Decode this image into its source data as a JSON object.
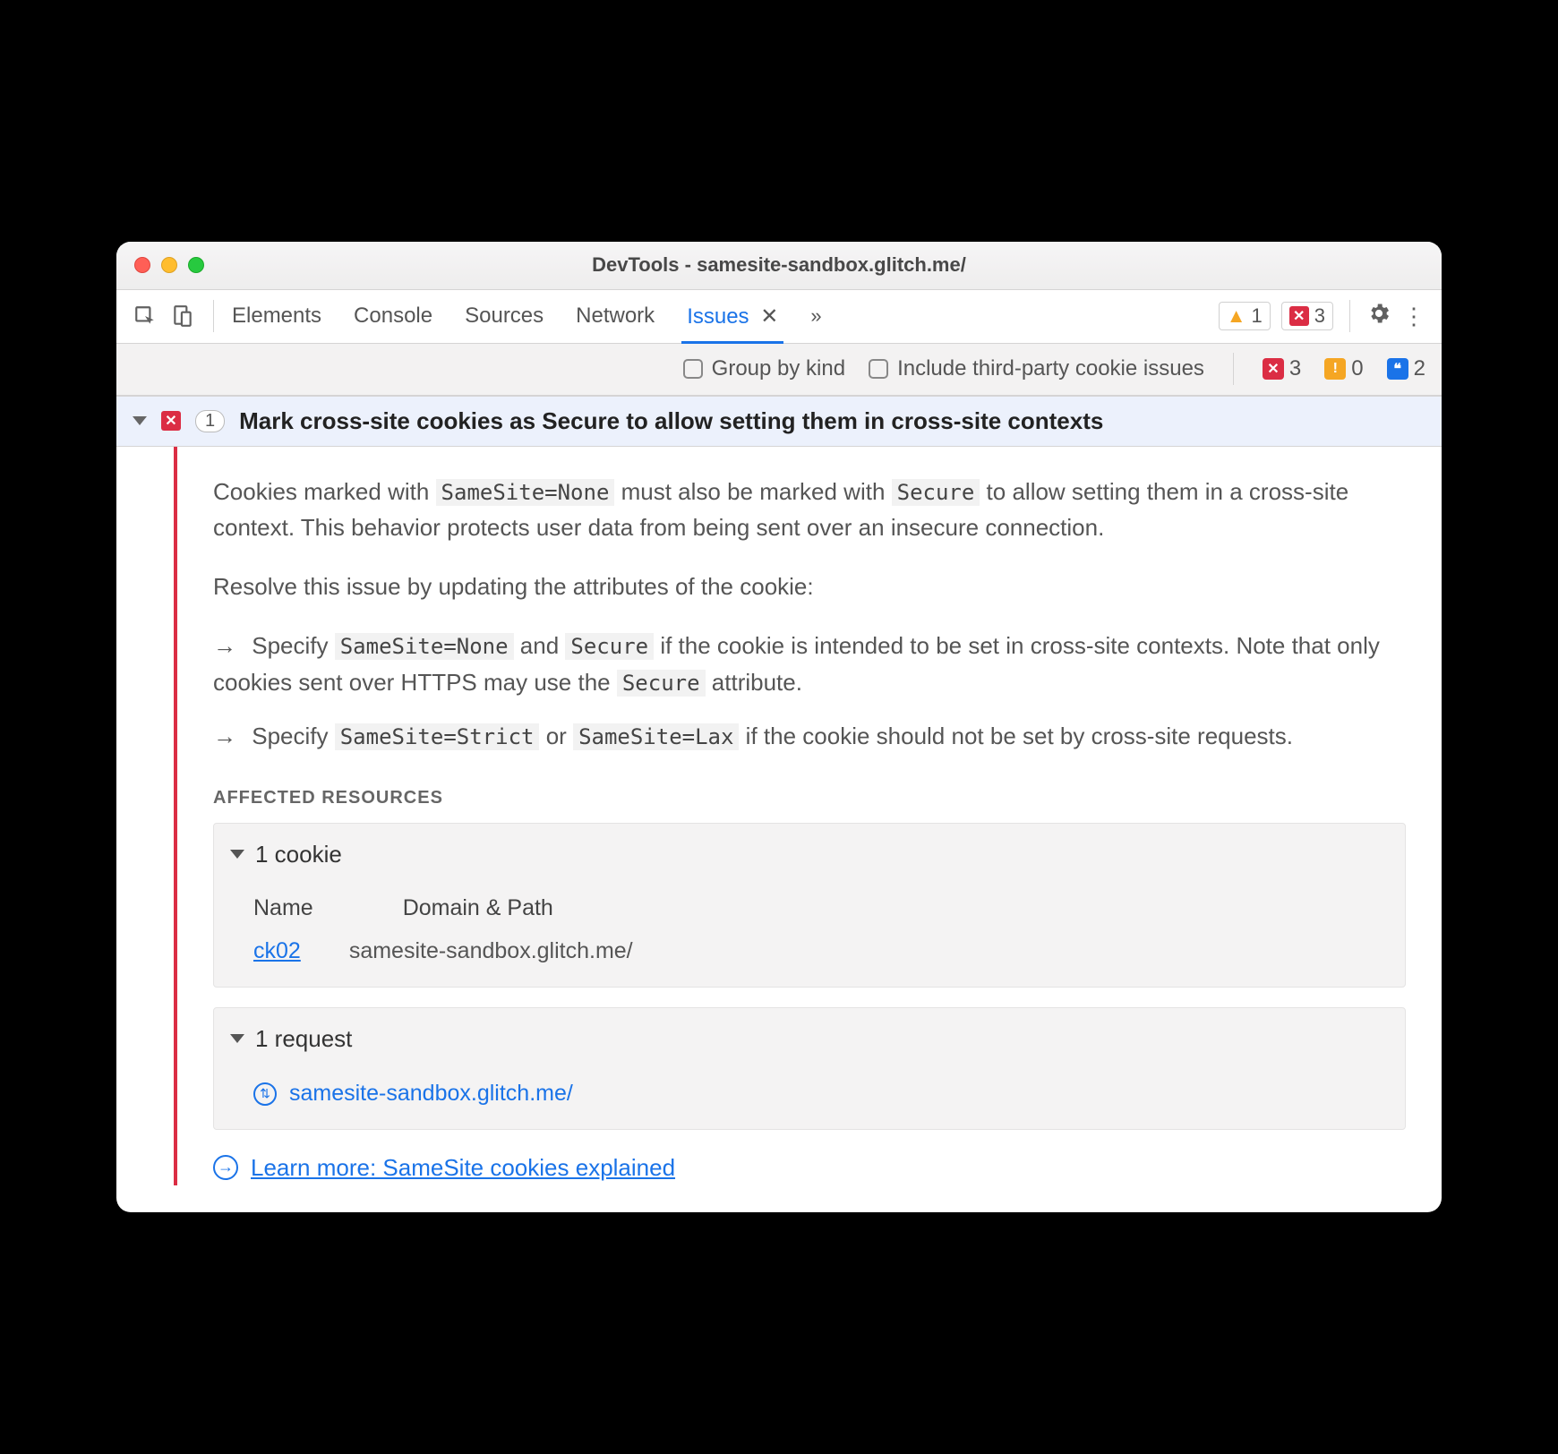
{
  "window": {
    "title": "DevTools - samesite-sandbox.glitch.me/"
  },
  "toolbar": {
    "tabs": [
      "Elements",
      "Console",
      "Sources",
      "Network",
      "Issues"
    ],
    "active_tab_index": 4,
    "warn_count": "1",
    "error_count": "3"
  },
  "filter": {
    "group_by_kind": "Group by kind",
    "include_third_party": "Include third-party cookie issues",
    "flags": {
      "errors": "3",
      "warnings": "0",
      "info": "2"
    }
  },
  "issue": {
    "count": "1",
    "title": "Mark cross-site cookies as Secure to allow setting them in cross-site contexts",
    "p1a": "Cookies marked with ",
    "code1": "SameSite=None",
    "p1b": " must also be marked with ",
    "code2": "Secure",
    "p1c": " to allow setting them in a cross-site context. This behavior protects user data from being sent over an insecure connection.",
    "p2": "Resolve this issue by updating the attributes of the cookie:",
    "bullet1a": "Specify ",
    "b1code1": "SameSite=None",
    "bullet1b": " and ",
    "b1code2": "Secure",
    "bullet1c": " if the cookie is intended to be set in cross-site contexts. Note that only cookies sent over HTTPS may use the ",
    "b1code3": "Secure",
    "bullet1d": " attribute.",
    "bullet2a": "Specify ",
    "b2code1": "SameSite=Strict",
    "bullet2b": " or ",
    "b2code2": "SameSite=Lax",
    "bullet2c": " if the cookie should not be set by cross-site requests.",
    "affected_label": "AFFECTED RESOURCES",
    "cookie_panel": {
      "header": "1 cookie",
      "col_name": "Name",
      "col_domain": "Domain & Path",
      "row_name": "ck02",
      "row_domain": "samesite-sandbox.glitch.me/"
    },
    "request_panel": {
      "header": "1 request",
      "url": "samesite-sandbox.glitch.me/"
    },
    "learn_more": "Learn more: SameSite cookies explained"
  }
}
